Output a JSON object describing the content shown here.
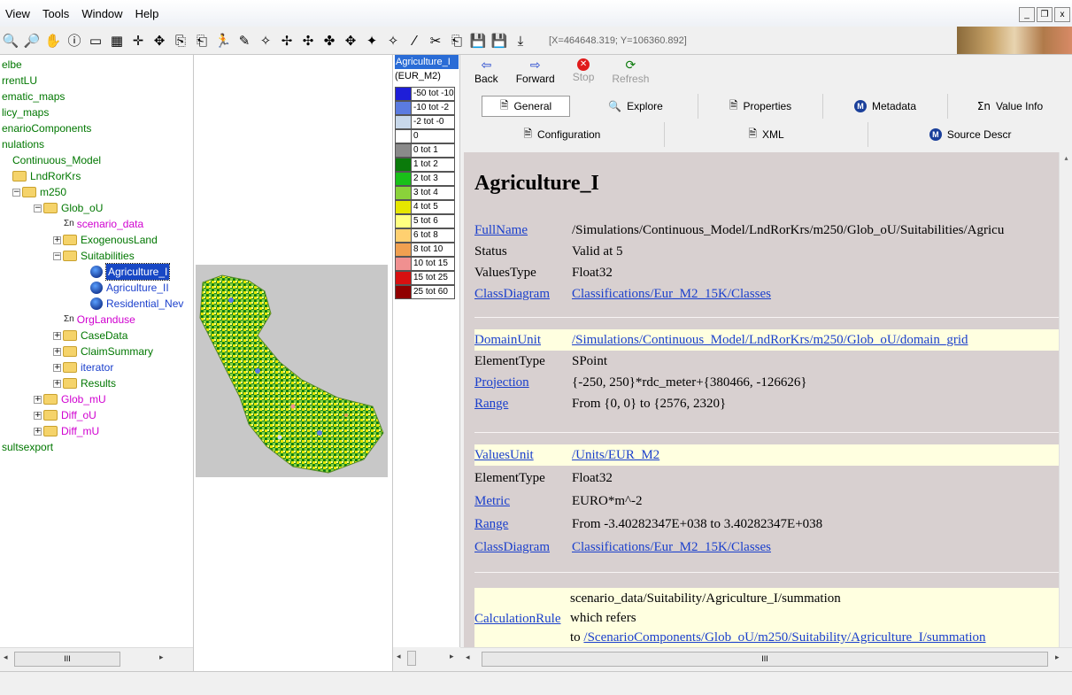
{
  "menu": {
    "items": [
      "View",
      "Tools",
      "Window",
      "Help"
    ]
  },
  "window_buttons": {
    "minimize": "_",
    "restore": "❐",
    "close": "x"
  },
  "toolbar": {
    "coords": "[X=464648.319; Y=106360.892]",
    "icons": [
      "zoom-out-icon",
      "zoom-in-icon",
      "pan-hand-icon",
      "info-icon",
      "select-rect-icon",
      "table-icon",
      "crosshair-icon",
      "move-icon",
      "copy-icon",
      "paste-icon",
      "run-icon",
      "brush-icon",
      "node-icon",
      "node-add-icon",
      "node-remove-icon",
      "node-move-icon",
      "node-split-icon",
      "vertex-icon",
      "vertex-add-icon",
      "line-icon",
      "cut-icon",
      "paste-feature-icon",
      "save-icon",
      "save-as-icon",
      "export-icon"
    ]
  },
  "tree": {
    "items": [
      {
        "label": "elbe",
        "color": "green",
        "indent": 0
      },
      {
        "label": "rrentLU",
        "color": "green",
        "indent": 0
      },
      {
        "label": "ematic_maps",
        "color": "green",
        "indent": 0
      },
      {
        "label": "licy_maps",
        "color": "green",
        "indent": 0
      },
      {
        "label": "enarioComponents",
        "color": "green",
        "indent": 0
      },
      {
        "label": "nulations",
        "color": "green",
        "indent": 0
      },
      {
        "label": "Continuous_Model",
        "color": "green",
        "indent": 1
      },
      {
        "label": "LndRorKrs",
        "color": "green",
        "indent": 2
      },
      {
        "label": "m250",
        "color": "green",
        "indent": 3
      },
      {
        "label": "Glob_oU",
        "color": "green",
        "indent": 4
      },
      {
        "label": "scenario_data",
        "color": "magenta",
        "indent": 5
      },
      {
        "label": "ExogenousLand",
        "color": "green",
        "indent": 5
      },
      {
        "label": "Suitabilities",
        "color": "green",
        "indent": 5
      },
      {
        "label": "Agriculture_I",
        "color": "selected",
        "indent": 6
      },
      {
        "label": "Agriculture_II",
        "color": "blue",
        "indent": 6
      },
      {
        "label": "Residential_Nev",
        "color": "blue",
        "indent": 6
      },
      {
        "label": "OrgLanduse",
        "color": "magenta",
        "indent": 5
      },
      {
        "label": "CaseData",
        "color": "green",
        "indent": 5
      },
      {
        "label": "ClaimSummary",
        "color": "green",
        "indent": 5
      },
      {
        "label": "iterator",
        "color": "green",
        "indent": 5
      },
      {
        "label": "Results",
        "color": "green",
        "indent": 5
      },
      {
        "label": "Glob_mU",
        "color": "magenta",
        "indent": 4
      },
      {
        "label": "Diff_oU",
        "color": "magenta",
        "indent": 4
      },
      {
        "label": "Diff_mU",
        "color": "magenta",
        "indent": 4
      },
      {
        "label": "sultsexport",
        "color": "green",
        "indent": 0
      }
    ]
  },
  "legend": {
    "title": "Agriculture_I",
    "unit": "(EUR_M2)",
    "entries": [
      {
        "label": "-50 tot -10",
        "color": "#1e1ed8"
      },
      {
        "label": "-10 tot -2",
        "color": "#5b7be0"
      },
      {
        "label": "-2 tot -0",
        "color": "#c8d8ea"
      },
      {
        "label": "0",
        "color": "#ffffff"
      },
      {
        "label": "0 tot 1",
        "color": "#8a8a8a"
      },
      {
        "label": "1 tot 2",
        "color": "#0a7a0a"
      },
      {
        "label": "2 tot 3",
        "color": "#19c019"
      },
      {
        "label": "3 tot 4",
        "color": "#8ad23a"
      },
      {
        "label": "4 tot 5",
        "color": "#e6e600"
      },
      {
        "label": "5 tot 6",
        "color": "#ffff80"
      },
      {
        "label": "6 tot 8",
        "color": "#ffd070"
      },
      {
        "label": "8 tot 10",
        "color": "#f0a050"
      },
      {
        "label": "10 tot 15",
        "color": "#f09090"
      },
      {
        "label": "15 tot 25",
        "color": "#d81010"
      },
      {
        "label": "25 tot 60",
        "color": "#900000"
      }
    ]
  },
  "nav": {
    "back": "Back",
    "forward": "Forward",
    "stop": "Stop",
    "refresh": "Refresh"
  },
  "tabs": {
    "general": "General",
    "explore": "Explore",
    "properties": "Properties",
    "metadata": "Metadata",
    "value_info": "Value Info",
    "configuration": "Configuration",
    "xml": "XML",
    "source_descr": "Source Descr"
  },
  "details": {
    "title": "Agriculture_I",
    "fullname_label": "FullName",
    "fullname_value": "/Simulations/Continuous_Model/LndRorKrs/m250/Glob_oU/Suitabilities/Agricu",
    "status_label": "Status",
    "status_value": "Valid at 5",
    "valuestype_label": "ValuesType",
    "valuestype_value": "Float32",
    "classdiagram_label": "ClassDiagram",
    "classdiagram_value": "Classifications/Eur_M2_15K/Classes",
    "domainunit_label": "DomainUnit",
    "domainunit_value": "/Simulations/Continuous_Model/LndRorKrs/m250/Glob_oU/domain_grid",
    "elementtype_label": "ElementType",
    "elementtype_value": "SPoint",
    "projection_label": "Projection",
    "projection_value": "{-250, 250}*rdc_meter+{380466, -126626}",
    "range_label": "Range",
    "range_value": "From {0, 0} to {2576, 2320}",
    "valuesunit_label": "ValuesUnit",
    "valuesunit_value": "/Units/EUR_M2",
    "elementtype2_label": "ElementType",
    "elementtype2_value": "Float32",
    "metric_label": "Metric",
    "metric_value": "EURO*m^-2",
    "range2_label": "Range",
    "range2_value": "From -3.40282347E+038 to 3.40282347E+038",
    "classdiagram2_label": "ClassDiagram",
    "classdiagram2_value": "Classifications/Eur_M2_15K/Classes",
    "calcrule_label": "CalculationRule",
    "calcrule_line1": "scenario_data/Suitability/Agriculture_I/summation",
    "calcrule_line2": "which refers",
    "calcrule_line3_prefix": "to ",
    "calcrule_line3_link": "/ScenarioComponents/Glob_oU/m250/Suitability/Agriculture_I/summation"
  },
  "scrollbar": {
    "grip": "III"
  },
  "colors": {
    "selection": "#1747c5",
    "link": "#1a3fcc",
    "highlight_row": "#ffffe0",
    "panel_bg": "#d8d0d0"
  }
}
